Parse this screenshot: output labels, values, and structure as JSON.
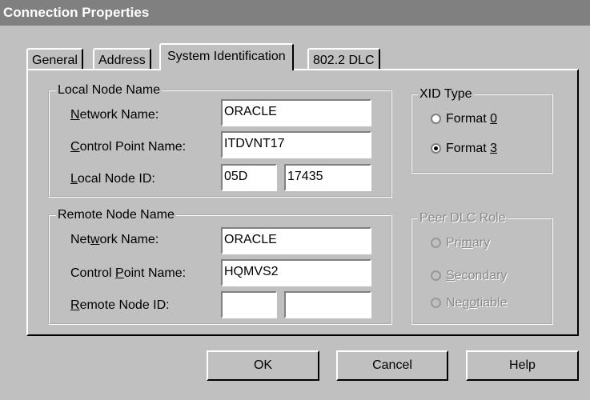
{
  "window": {
    "title": "Connection Properties"
  },
  "tabs": [
    {
      "label": "General"
    },
    {
      "label": "Address"
    },
    {
      "label": "System Identification"
    },
    {
      "label": "802.2 DLC"
    }
  ],
  "local_node": {
    "legend": "Local Node Name",
    "network_name": {
      "pre": "",
      "key": "N",
      "post": "etwork Name:",
      "value": "ORACLE"
    },
    "control_point": {
      "pre": "",
      "key": "C",
      "post": "ontrol Point Name:",
      "value": "ITDVNT17"
    },
    "node_id": {
      "pre": "",
      "key": "L",
      "post": "ocal Node ID:",
      "value1": "05D",
      "value2": "17435"
    }
  },
  "remote_node": {
    "legend": "Remote Node Name",
    "network_name": {
      "pre": "Net",
      "key": "w",
      "post": "ork Name:",
      "value": "ORACLE"
    },
    "control_point": {
      "pre": "Control ",
      "key": "P",
      "post": "oint Name:",
      "value": "HQMVS2"
    },
    "node_id": {
      "pre": "",
      "key": "R",
      "post": "emote Node ID:",
      "value1": "",
      "value2": ""
    }
  },
  "xid_type": {
    "legend": "XID Type",
    "options": [
      {
        "pre": "Format ",
        "key": "0",
        "post": "",
        "selected": false
      },
      {
        "pre": "Format ",
        "key": "3",
        "post": "",
        "selected": true
      }
    ]
  },
  "peer_dlc_role": {
    "legend": "Peer DLC Role",
    "options": [
      {
        "pre": "Pri",
        "key": "m",
        "post": "ary"
      },
      {
        "pre": "",
        "key": "S",
        "post": "econdary"
      },
      {
        "pre": "Neg",
        "key": "o",
        "post": "tiable"
      }
    ]
  },
  "buttons": {
    "ok": "OK",
    "cancel": "Cancel",
    "help": "Help"
  }
}
